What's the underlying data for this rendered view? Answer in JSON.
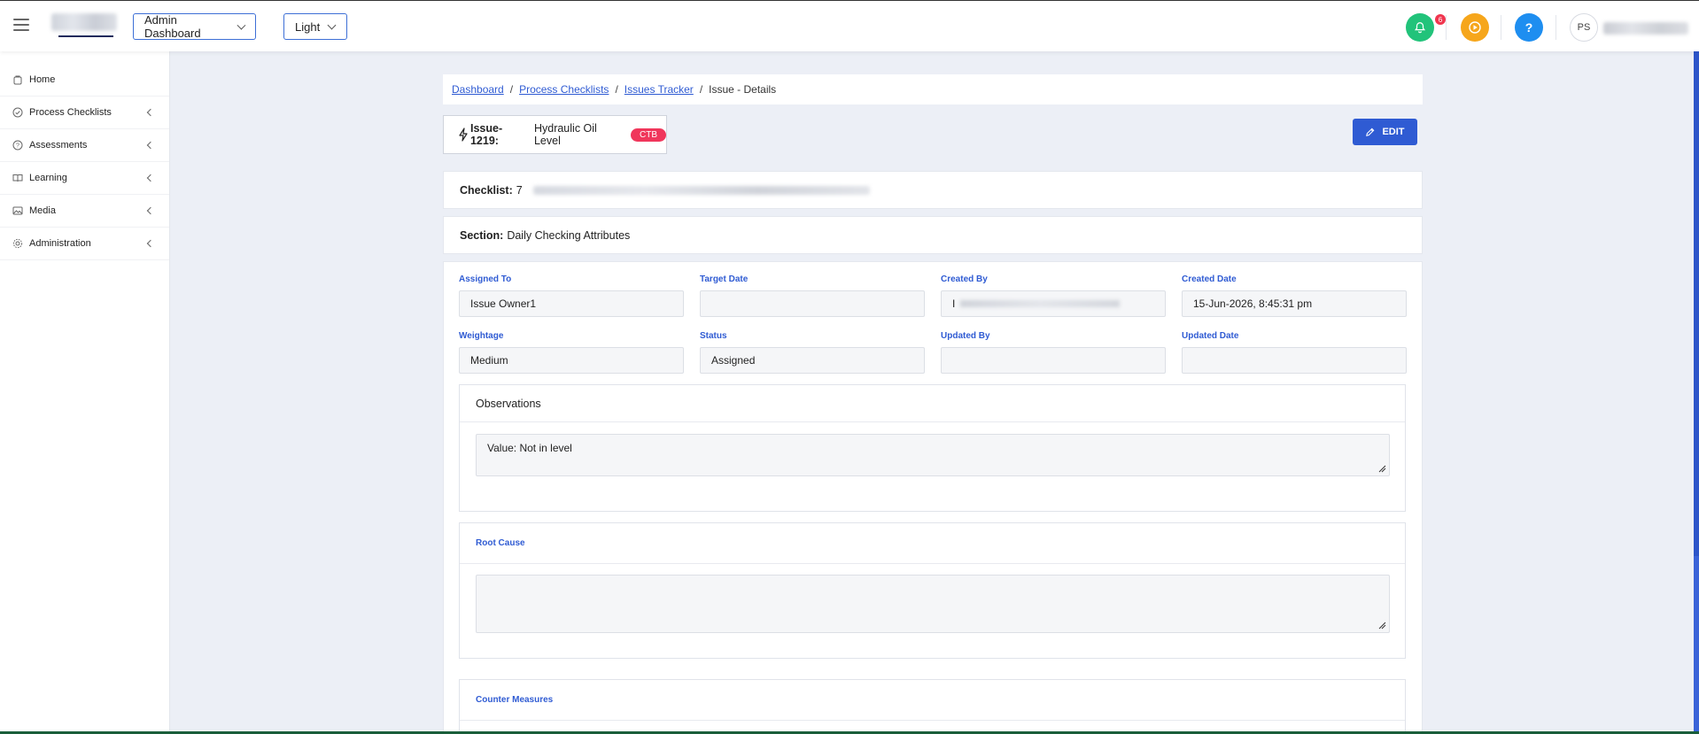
{
  "topbar": {
    "dashboard_select": "Admin Dashboard",
    "theme_select": "Light",
    "notification_count": "6",
    "help_label": "?",
    "avatar_initials": "PS"
  },
  "sidebar": {
    "items": [
      {
        "label": "Home",
        "icon": "home-icon",
        "has_arrow": false
      },
      {
        "label": "Process Checklists",
        "icon": "check-circle-icon",
        "has_arrow": true
      },
      {
        "label": "Assessments",
        "icon": "question-circle-icon",
        "has_arrow": true
      },
      {
        "label": "Learning",
        "icon": "book-icon",
        "has_arrow": true
      },
      {
        "label": "Media",
        "icon": "image-icon",
        "has_arrow": true
      },
      {
        "label": "Administration",
        "icon": "gear-icon",
        "has_arrow": true
      }
    ]
  },
  "breadcrumb": {
    "items": [
      "Dashboard",
      "Process Checklists",
      "Issues Tracker"
    ],
    "current": "Issue - Details"
  },
  "issue": {
    "number": "Issue-1219:",
    "title": "Hydraulic Oil Level",
    "tag": "CTB",
    "edit_label": "EDIT"
  },
  "checklist": {
    "label": "Checklist:",
    "value": "7"
  },
  "section": {
    "label": "Section:",
    "value": "Daily Checking Attributes"
  },
  "fields": {
    "assigned_to": {
      "label": "Assigned To",
      "value": "Issue Owner1"
    },
    "target_date": {
      "label": "Target Date",
      "value": ""
    },
    "created_by": {
      "label": "Created By",
      "value": "I"
    },
    "created_date": {
      "label": "Created Date",
      "value": "15-Jun-2026, 8:45:31 pm"
    },
    "weightage": {
      "label": "Weightage",
      "value": "Medium"
    },
    "status": {
      "label": "Status",
      "value": "Assigned"
    },
    "updated_by": {
      "label": "Updated By",
      "value": ""
    },
    "updated_date": {
      "label": "Updated Date",
      "value": ""
    }
  },
  "observations": {
    "title": "Observations",
    "value": "Value: Not in level"
  },
  "root_cause": {
    "title": "Root Cause",
    "value": ""
  },
  "counter_measures": {
    "title": "Counter Measures"
  },
  "colors": {
    "primary": "#2f5bd3",
    "bell": "#21c37a",
    "play": "#f6a61b",
    "help": "#1e8ef0",
    "tag": "#f0365b"
  }
}
